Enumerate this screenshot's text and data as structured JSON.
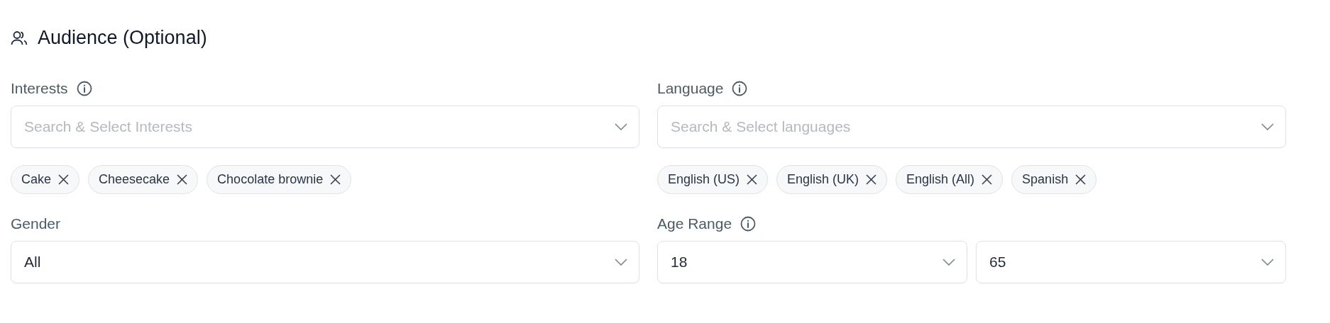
{
  "section": {
    "title": "Audience (Optional)"
  },
  "fields": [
    {
      "kind": "multiselect",
      "label": "Interests",
      "info": true,
      "placeholder": "Search & Select Interests",
      "chips": [
        "Cake",
        "Cheesecake",
        "Chocolate brownie"
      ]
    },
    {
      "kind": "multiselect",
      "label": "Language",
      "info": true,
      "placeholder": "Search & Select languages",
      "chips": [
        "English (US)",
        "English (UK)",
        "English (All)",
        "Spanish"
      ]
    },
    {
      "kind": "select",
      "label": "Gender",
      "info": false,
      "value": "All"
    },
    {
      "kind": "range",
      "label": "Age Range",
      "info": true,
      "values": [
        "18",
        "65"
      ]
    }
  ]
}
